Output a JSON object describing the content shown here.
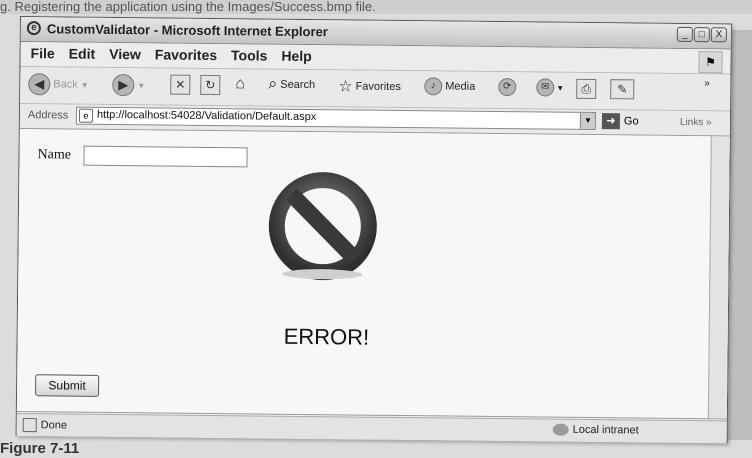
{
  "header_text": "g. Registering the application using the Images/Success.bmp file.",
  "window": {
    "title": "CustomValidator - Microsoft Internet Explorer",
    "controls": [
      "_",
      "□",
      "X"
    ]
  },
  "menu": [
    "File",
    "Edit",
    "View",
    "Favorites",
    "Tools",
    "Help"
  ],
  "toolbar": {
    "back_label": "Back",
    "search_label": "Search",
    "favorites_label": "Favorites",
    "media_label": "Media"
  },
  "address": {
    "label": "Address",
    "url": "http://localhost:54028/Validation/Default.aspx",
    "go_label": "Go",
    "links_label": "Links"
  },
  "page": {
    "name_label": "Name",
    "name_value": "",
    "error_text": "ERROR!",
    "submit_label": "Submit"
  },
  "status": {
    "text": "Done",
    "zone": "Local intranet"
  },
  "caption": "Figure 7-11"
}
